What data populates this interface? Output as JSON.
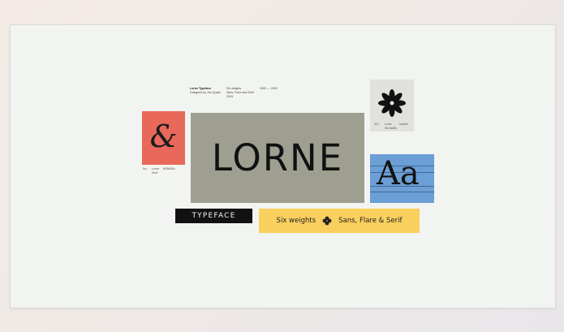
{
  "meta": {
    "col1": [
      "Lorne Typeface",
      "Designed by Jon Quach"
    ],
    "col2": [
      "Six weights",
      "Sans, Flare and Serif",
      "2019"
    ],
    "col3": [
      "2000 — 2020"
    ]
  },
  "amp_card": {
    "glyph": "&",
    "caption": [
      "No.",
      "Lorne",
      "Serif",
      "#E8695A"
    ]
  },
  "hero": {
    "wordmark": "LORNE"
  },
  "flower_card": {
    "icon": "flower-icon",
    "caption": [
      "014",
      "Lorne",
      "Six Motifs",
      "Iconfile"
    ]
  },
  "aa_card": {
    "glyph": "Aa"
  },
  "typeface_label": "TYPEFACE",
  "weights_banner": {
    "left": "Six weights",
    "right": "Sans, Flare & Serif",
    "separator_icon": "quatrefoil-icon"
  },
  "colors": {
    "frame": "#f2f4f1",
    "coral": "#e8695a",
    "olive_gray": "#9f9f91",
    "blue": "#6b9fd6",
    "yellow": "#f9cf5e",
    "black": "#111111",
    "light_gray": "#e1e2de"
  }
}
